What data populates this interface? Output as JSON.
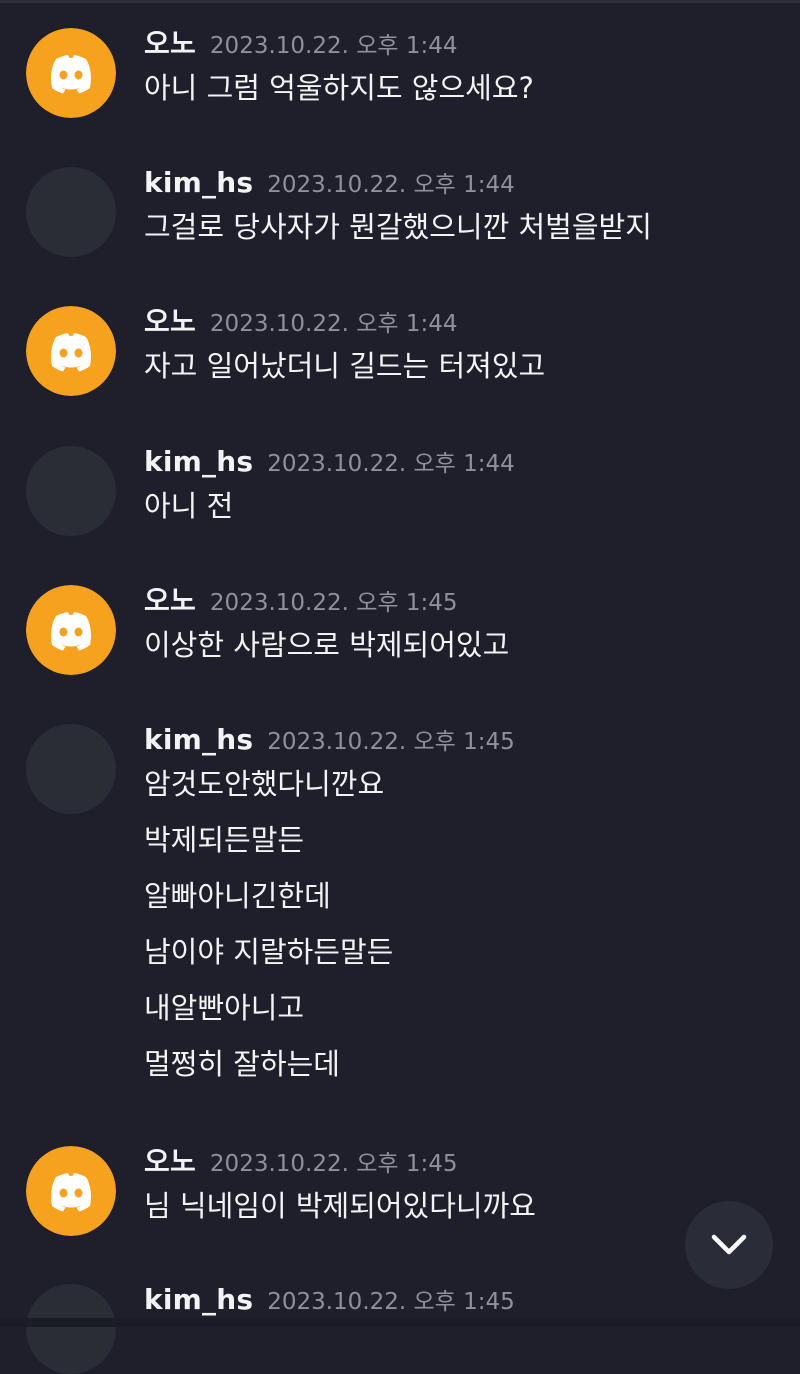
{
  "brand_color": "#f6a21e",
  "icons": {
    "avatar_logo": "discord-logo-icon",
    "scroll": "chevron-down-icon"
  },
  "messages": [
    {
      "author": "오노",
      "time": "2023.10.22. 오후 1:44",
      "avatar": "discord-logo",
      "lines": [
        "아니 그럼 억울하지도 않으세요?"
      ]
    },
    {
      "author": "kim_hs",
      "time": "2023.10.22. 오후 1:44",
      "avatar": "plain",
      "lines": [
        "그걸로 당사자가 뭔갈했으니깐 처벌을받지"
      ]
    },
    {
      "author": "오노",
      "time": "2023.10.22. 오후 1:44",
      "avatar": "discord-logo",
      "lines": [
        "자고 일어났더니 길드는 터져있고"
      ]
    },
    {
      "author": "kim_hs",
      "time": "2023.10.22. 오후 1:44",
      "avatar": "plain",
      "lines": [
        "아니 전"
      ]
    },
    {
      "author": "오노",
      "time": "2023.10.22. 오후 1:45",
      "avatar": "discord-logo",
      "lines": [
        "이상한 사람으로 박제되어있고"
      ]
    },
    {
      "author": "kim_hs",
      "time": "2023.10.22. 오후 1:45",
      "avatar": "plain",
      "lines": [
        "암것도안했다니깐요",
        "박제되든말든",
        "알빠아니긴한데",
        "남이야 지랄하든말든",
        "내알빤아니고",
        "멀쩡히 잘하는데"
      ]
    },
    {
      "author": "오노",
      "time": "2023.10.22. 오후 1:45",
      "avatar": "discord-logo",
      "lines": [
        "님 닉네임이 박제되어있다니까요"
      ]
    },
    {
      "author": "kim_hs",
      "time": "2023.10.22. 오후 1:45",
      "avatar": "plain",
      "lines": []
    }
  ]
}
